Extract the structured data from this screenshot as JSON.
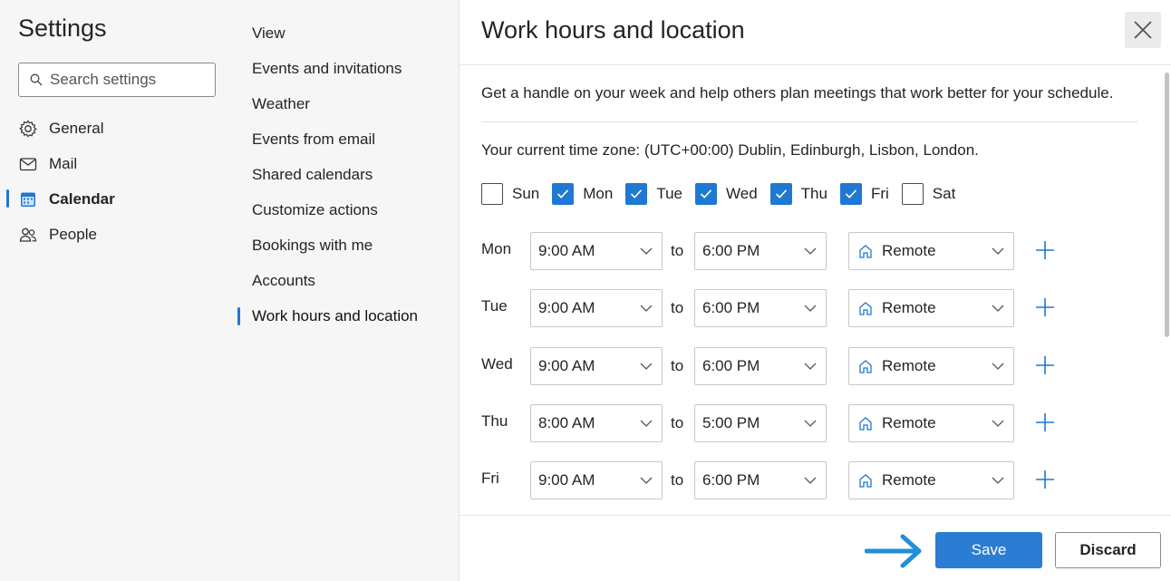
{
  "settings": {
    "title": "Settings",
    "search_placeholder": "Search settings",
    "nav": [
      {
        "label": "General",
        "icon": "gear-icon"
      },
      {
        "label": "Mail",
        "icon": "mail-icon"
      },
      {
        "label": "Calendar",
        "icon": "calendar-icon",
        "active": true
      },
      {
        "label": "People",
        "icon": "people-icon"
      }
    ]
  },
  "calendar_menu": {
    "items": [
      "View",
      "Events and invitations",
      "Weather",
      "Events from email",
      "Shared calendars",
      "Customize actions",
      "Bookings with me",
      "Accounts",
      "Work hours and location"
    ],
    "active_index": 8
  },
  "panel": {
    "title": "Work hours and location",
    "description": "Get a handle on your week and help others plan meetings that work better for your schedule.",
    "timezone": "Your current time zone: (UTC+00:00) Dublin, Edinburgh, Lisbon, London.",
    "days": [
      {
        "label": "Sun",
        "checked": false
      },
      {
        "label": "Mon",
        "checked": true
      },
      {
        "label": "Tue",
        "checked": true
      },
      {
        "label": "Wed",
        "checked": true
      },
      {
        "label": "Thu",
        "checked": true
      },
      {
        "label": "Fri",
        "checked": true
      },
      {
        "label": "Sat",
        "checked": false
      }
    ],
    "to_label": "to",
    "schedule": [
      {
        "day": "Mon",
        "start": "9:00 AM",
        "end": "6:00 PM",
        "location": "Remote"
      },
      {
        "day": "Tue",
        "start": "9:00 AM",
        "end": "6:00 PM",
        "location": "Remote"
      },
      {
        "day": "Wed",
        "start": "9:00 AM",
        "end": "6:00 PM",
        "location": "Remote"
      },
      {
        "day": "Thu",
        "start": "8:00 AM",
        "end": "5:00 PM",
        "location": "Remote"
      },
      {
        "day": "Fri",
        "start": "9:00 AM",
        "end": "6:00 PM",
        "location": "Remote"
      }
    ],
    "save_label": "Save",
    "discard_label": "Discard"
  },
  "colors": {
    "accent": "#1f78d1",
    "save_button": "#2b7cd3",
    "arrow": "#1f8fd8"
  }
}
